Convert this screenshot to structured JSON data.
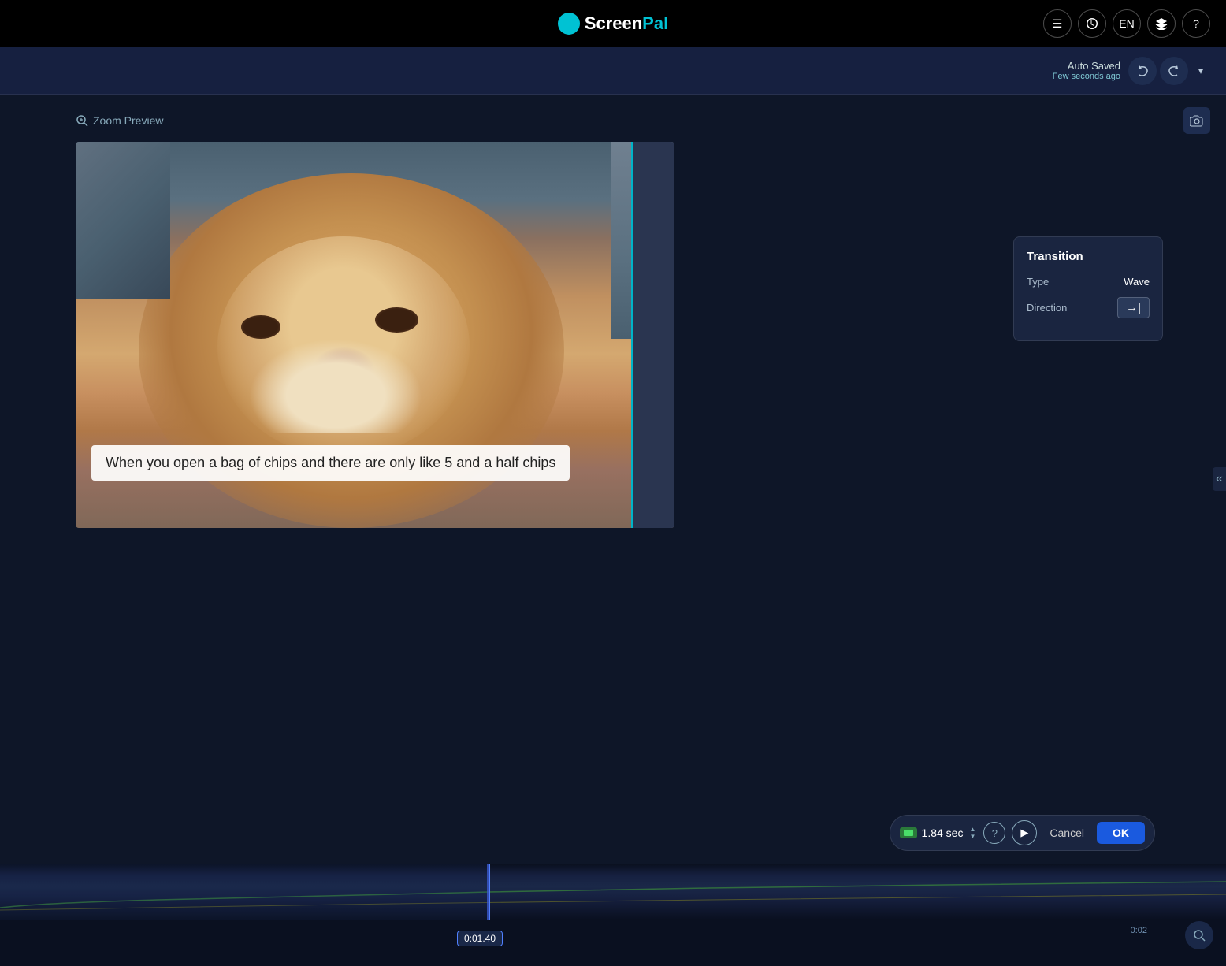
{
  "app": {
    "name": "ScreenPal",
    "logo_icon": "🎬"
  },
  "topbar": {
    "icons": [
      {
        "name": "menu-icon",
        "symbol": "☰",
        "label": "Menu"
      },
      {
        "name": "history-icon",
        "symbol": "⏱",
        "label": "History"
      },
      {
        "name": "language-icon",
        "symbol": "EN",
        "label": "Language"
      },
      {
        "name": "layers-icon",
        "symbol": "⊞",
        "label": "Layers"
      },
      {
        "name": "help-icon",
        "symbol": "?",
        "label": "Help"
      }
    ]
  },
  "secondbar": {
    "auto_saved_title": "Auto Saved",
    "auto_saved_sub": "Few seconds ago",
    "undo_icon": "↩",
    "redo_icon": "↪",
    "dropdown_icon": "▾"
  },
  "preview": {
    "zoom_label": "Zoom Preview",
    "camera_icon": "📷",
    "subtitle_text": "When you open a bag of chips and there are only like 5 and a half chips",
    "search_icon": "🔍"
  },
  "transition": {
    "title": "Transition",
    "type_label": "Type",
    "type_value": "Wave",
    "direction_label": "Direction",
    "direction_icon": "→|"
  },
  "playback": {
    "duration": "1.84 sec",
    "help_label": "?",
    "play_icon": "▶",
    "cancel_label": "Cancel",
    "ok_label": "OK"
  },
  "timeline": {
    "playhead_time": "0:01.40",
    "end_marker": "0:02",
    "search_icon": "🔍"
  },
  "collapse": {
    "icon": "«"
  }
}
